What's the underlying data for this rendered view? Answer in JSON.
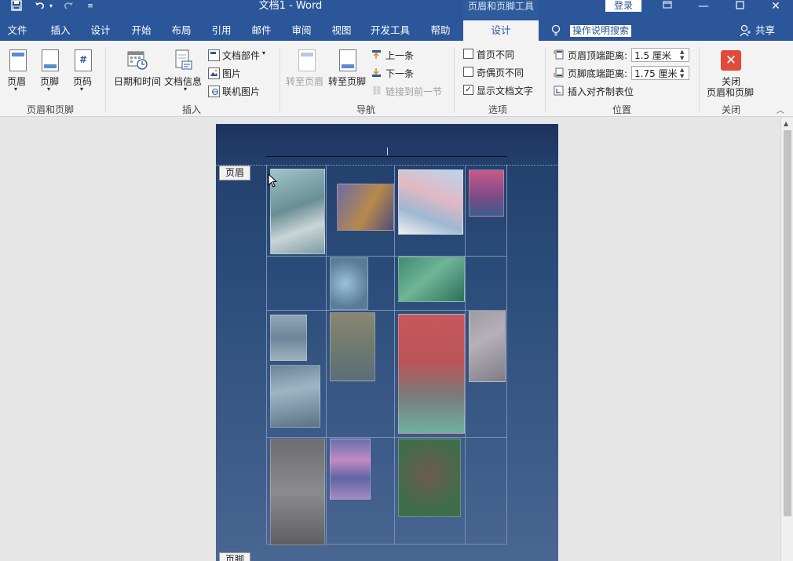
{
  "window": {
    "title": "文档1  -  Word",
    "context_tool": "页眉和页脚工具",
    "login": "登录"
  },
  "quick_access": {
    "save_icon": "save-icon",
    "undo_icon": "undo-icon",
    "redo_icon": "redo-icon",
    "customize_icon": "customize-icon"
  },
  "tabs": [
    "文件",
    "插入",
    "设计",
    "开始",
    "布局",
    "引用",
    "邮件",
    "审阅",
    "视图",
    "开发工具",
    "帮助",
    "设计"
  ],
  "tell_me": "操作说明搜索",
  "share": "共享",
  "ribbon": {
    "header_footer": {
      "header": "页眉",
      "footer": "页脚",
      "page_number": "页码",
      "group": "页眉和页脚"
    },
    "insert": {
      "date_time": "日期和时间",
      "doc_info": "文档信息",
      "doc_parts": "文档部件",
      "picture": "图片",
      "online_picture": "联机图片",
      "group": "插入"
    },
    "navigation": {
      "go_to_header": "转至页眉",
      "go_to_footer": "转至页脚",
      "previous": "上一条",
      "next": "下一条",
      "link_to_previous": "链接到前一节",
      "group": "导航"
    },
    "options": {
      "different_first_page": "首页不同",
      "different_odd_even": "奇偶页不同",
      "show_document_text": "显示文档文字",
      "checked": [
        false,
        false,
        true
      ],
      "group": "选项"
    },
    "position": {
      "header_from_top": "页眉顶端距离:",
      "header_from_top_value": "1.5 厘米",
      "footer_from_bottom": "页脚底端距离:",
      "footer_from_bottom_value": "1.75 厘米",
      "insert_alignment_tab": "插入对齐制表位",
      "group": "位置"
    },
    "close": {
      "label_line1": "关闭",
      "label_line2": "页眉和页脚",
      "group": "关闭"
    }
  },
  "document": {
    "header_tag": "页眉",
    "footer_tag": "页脚"
  },
  "colors": {
    "word_blue": "#2b579a",
    "ribbon_bg": "#f3f3f3",
    "close_red": "#e04a3a"
  }
}
